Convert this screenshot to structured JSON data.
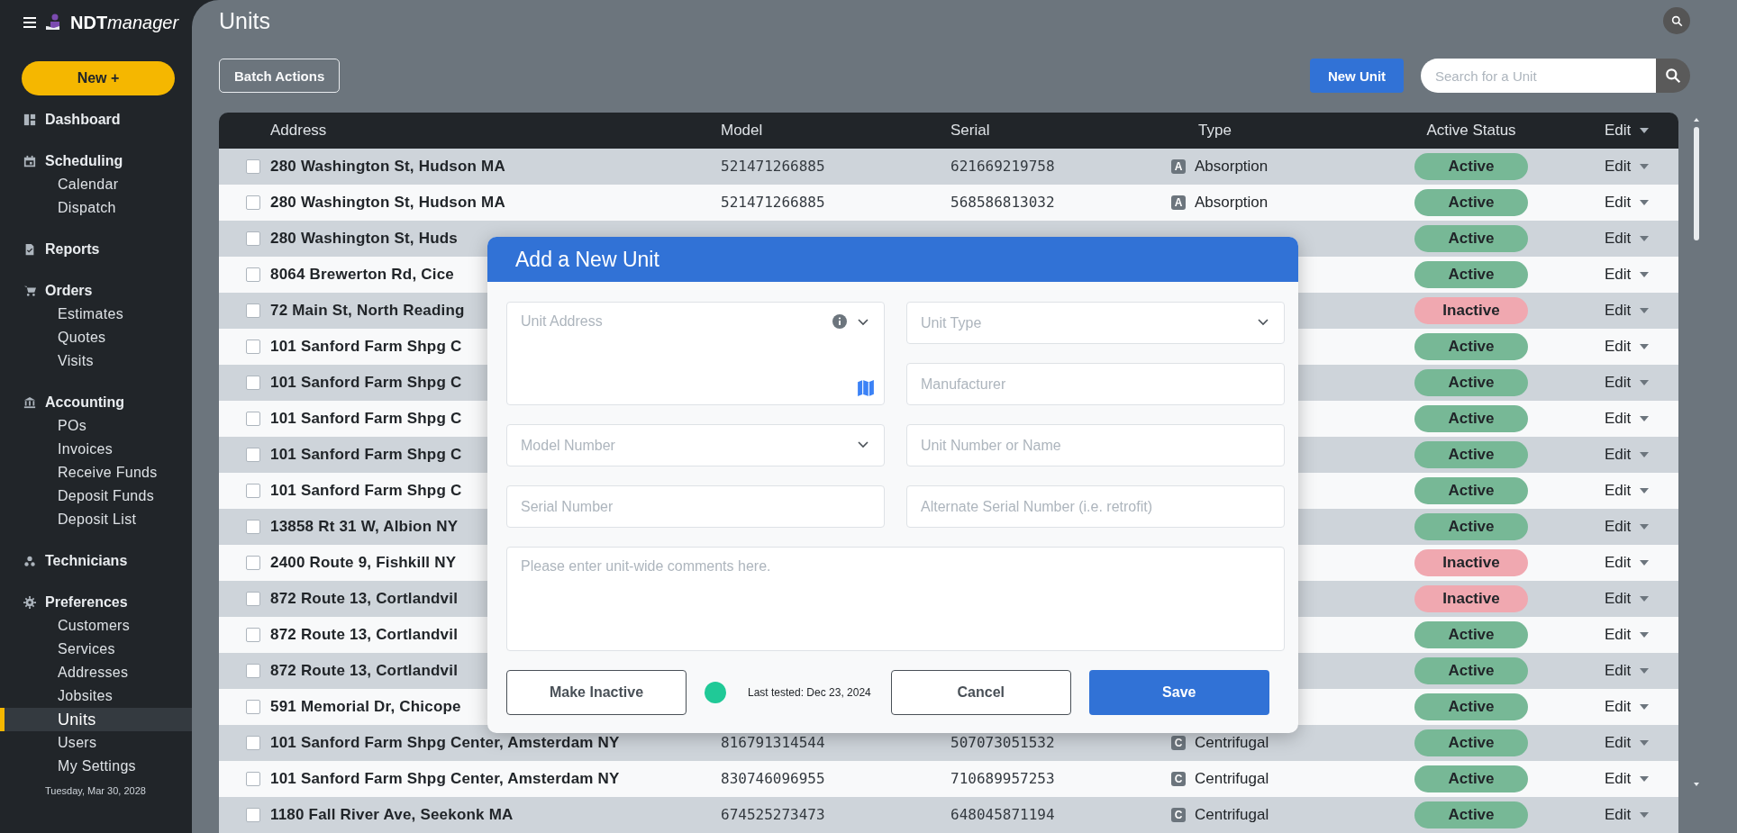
{
  "sidebar": {
    "brand": {
      "bold": "NDT",
      "light": "manager"
    },
    "new_button": "New +",
    "groups": [
      {
        "label": "Dashboard"
      },
      {
        "label": "Scheduling",
        "items": [
          {
            "label": "Calendar",
            "selected": false
          },
          {
            "label": "Dispatch",
            "selected": false
          }
        ]
      },
      {
        "label": "Reports"
      },
      {
        "label": "Orders",
        "items": [
          {
            "label": "Estimates",
            "selected": false
          },
          {
            "label": "Quotes",
            "selected": false
          },
          {
            "label": "Visits",
            "selected": false
          }
        ]
      },
      {
        "label": "Accounting",
        "items": [
          {
            "label": "POs",
            "selected": false
          },
          {
            "label": "Invoices",
            "selected": false
          },
          {
            "label": "Receive Funds",
            "selected": false
          },
          {
            "label": "Deposit Funds",
            "selected": false
          },
          {
            "label": "Deposit List",
            "selected": false
          }
        ]
      },
      {
        "label": "Technicians"
      },
      {
        "label": "Preferences",
        "items": [
          {
            "label": "Customers",
            "selected": false
          },
          {
            "label": "Services",
            "selected": false
          },
          {
            "label": "Addresses",
            "selected": false
          },
          {
            "label": "Jobsites",
            "selected": false
          },
          {
            "label": "Units",
            "selected": true
          },
          {
            "label": "Users",
            "selected": false
          },
          {
            "label": "My Settings",
            "selected": false
          }
        ]
      }
    ],
    "date": "Tuesday, Mar 30, 2028"
  },
  "page": {
    "title": "Units",
    "batch_button": "Batch Actions",
    "new_button": "New Unit",
    "search": {
      "placeholder": "Search for a Unit"
    }
  },
  "table": {
    "columns": [
      "Address",
      "Model",
      "Serial",
      "Type",
      "Active Status",
      "Edit"
    ],
    "rows": [
      {
        "checked": false,
        "address": "280 Washington St, Hudson MA",
        "model": "521471266885",
        "serial": "621669219758",
        "type_badge": "A",
        "type": "Absorption",
        "status": "Active",
        "active": true,
        "edit": "Edit"
      },
      {
        "checked": false,
        "address": "280 Washington St, Hudson MA",
        "model": "521471266885",
        "serial": "568586813032",
        "type_badge": "A",
        "type": "Absorption",
        "status": "Active",
        "active": true,
        "edit": "Edit"
      },
      {
        "checked": false,
        "address": "280 Washington St, Huds",
        "status": "Active",
        "active": true,
        "edit": "Edit"
      },
      {
        "checked": false,
        "address": "8064 Brewerton Rd, Cice",
        "status": "Active",
        "active": true,
        "edit": "Edit"
      },
      {
        "checked": false,
        "address": "72 Main St, North Reading",
        "status": "Inactive",
        "active": false,
        "edit": "Edit"
      },
      {
        "checked": false,
        "address": "101 Sanford Farm Shpg C",
        "status": "Active",
        "active": true,
        "edit": "Edit"
      },
      {
        "checked": false,
        "address": "101 Sanford Farm Shpg C",
        "status": "Active",
        "active": true,
        "edit": "Edit"
      },
      {
        "checked": false,
        "address": "101 Sanford Farm Shpg C",
        "status": "Active",
        "active": true,
        "edit": "Edit"
      },
      {
        "checked": false,
        "address": "101 Sanford Farm Shpg C",
        "status": "Active",
        "active": true,
        "edit": "Edit"
      },
      {
        "checked": false,
        "address": "101 Sanford Farm Shpg C",
        "status": "Active",
        "active": true,
        "edit": "Edit"
      },
      {
        "checked": false,
        "address": "13858 Rt 31 W, Albion NY",
        "status": "Active",
        "active": true,
        "edit": "Edit"
      },
      {
        "checked": false,
        "address": "2400 Route 9, Fishkill NY",
        "status": "Inactive",
        "active": false,
        "edit": "Edit"
      },
      {
        "checked": false,
        "address": "872 Route 13, Cortlandvil",
        "status": "Inactive",
        "active": false,
        "edit": "Edit"
      },
      {
        "checked": false,
        "address": "872 Route 13, Cortlandvil",
        "status": "Active",
        "active": true,
        "edit": "Edit"
      },
      {
        "checked": false,
        "address": "872 Route 13, Cortlandvil",
        "status": "Active",
        "active": true,
        "edit": "Edit"
      },
      {
        "checked": false,
        "address": "591 Memorial Dr, Chicope",
        "status": "Active",
        "active": true,
        "edit": "Edit"
      },
      {
        "checked": false,
        "address": "101 Sanford Farm Shpg Center, Amsterdam NY",
        "model": "816791314544",
        "serial": "507073051532",
        "type_badge": "C",
        "type": "Centrifugal",
        "status": "Active",
        "active": true,
        "edit": "Edit"
      },
      {
        "checked": false,
        "address": "101 Sanford Farm Shpg Center, Amsterdam NY",
        "model": "830746096955",
        "serial": "710689957253",
        "type_badge": "C",
        "type": "Centrifugal",
        "status": "Active",
        "active": true,
        "edit": "Edit"
      },
      {
        "checked": false,
        "address": "1180 Fall River Ave, Seekonk MA",
        "model": "674525273473",
        "serial": "648045871194",
        "type_badge": "C",
        "type": "Centrifugal",
        "status": "Active",
        "active": true,
        "edit": "Edit"
      }
    ]
  },
  "modal": {
    "title": "Add a New Unit",
    "fields": [
      {
        "kind": "address",
        "placeholder": "Unit Address"
      },
      {
        "kind": "select",
        "placeholder": "Unit Type"
      },
      {
        "kind": "text",
        "placeholder": "Manufacturer"
      },
      {
        "kind": "select",
        "placeholder": "Model Number"
      },
      {
        "kind": "text",
        "placeholder": "Unit Number or Name"
      },
      {
        "kind": "text",
        "placeholder": "Serial Number"
      },
      {
        "kind": "text",
        "placeholder": "Alternate Serial Number (i.e. retrofit)"
      },
      {
        "kind": "comments",
        "placeholder": "Please enter unit-wide comments here."
      }
    ],
    "inactive_button": "Make Inactive",
    "last_tested": "Last tested: Dec 23, 2024",
    "cancel_button": "Cancel",
    "save_button": "Save"
  }
}
